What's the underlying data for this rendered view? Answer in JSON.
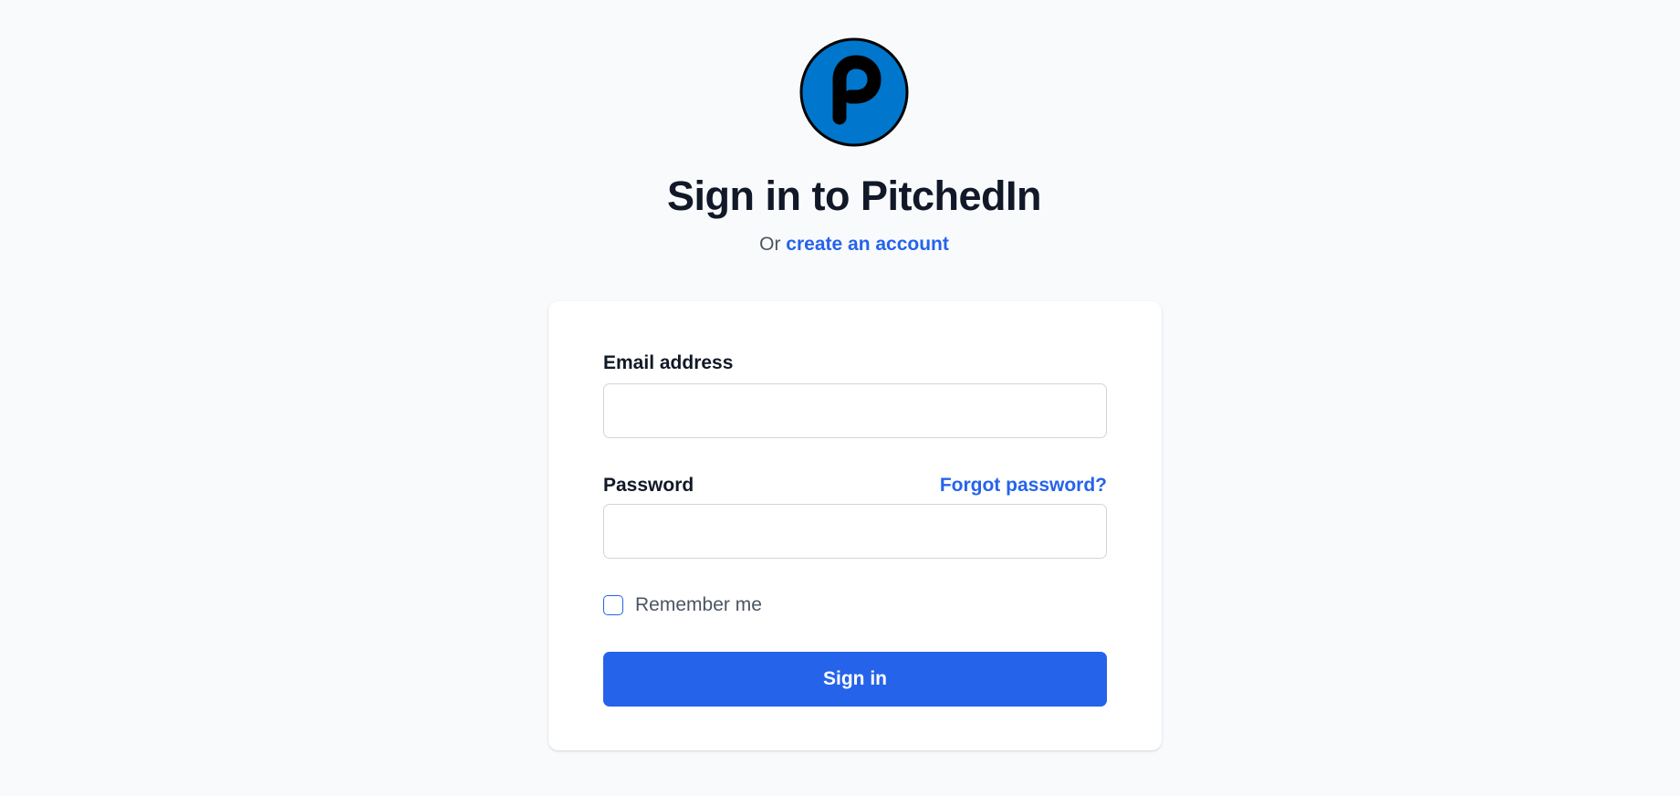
{
  "brand": {
    "name": "PitchedIn",
    "logo_icon": "pitchedin-p-logo",
    "logo_color": "#0077cc"
  },
  "header": {
    "title": "Sign in to PitchedIn",
    "subtitle_prefix": "Or",
    "create_account_link": "create an account"
  },
  "form": {
    "email_label": "Email address",
    "email_value": "",
    "password_label": "Password",
    "password_value": "",
    "forgot_password_link": "Forgot password?",
    "remember_me_label": "Remember me",
    "remember_me_checked": false,
    "submit_label": "Sign in"
  },
  "colors": {
    "accent": "#2563eb",
    "background": "#f8fafc",
    "card": "#ffffff"
  }
}
